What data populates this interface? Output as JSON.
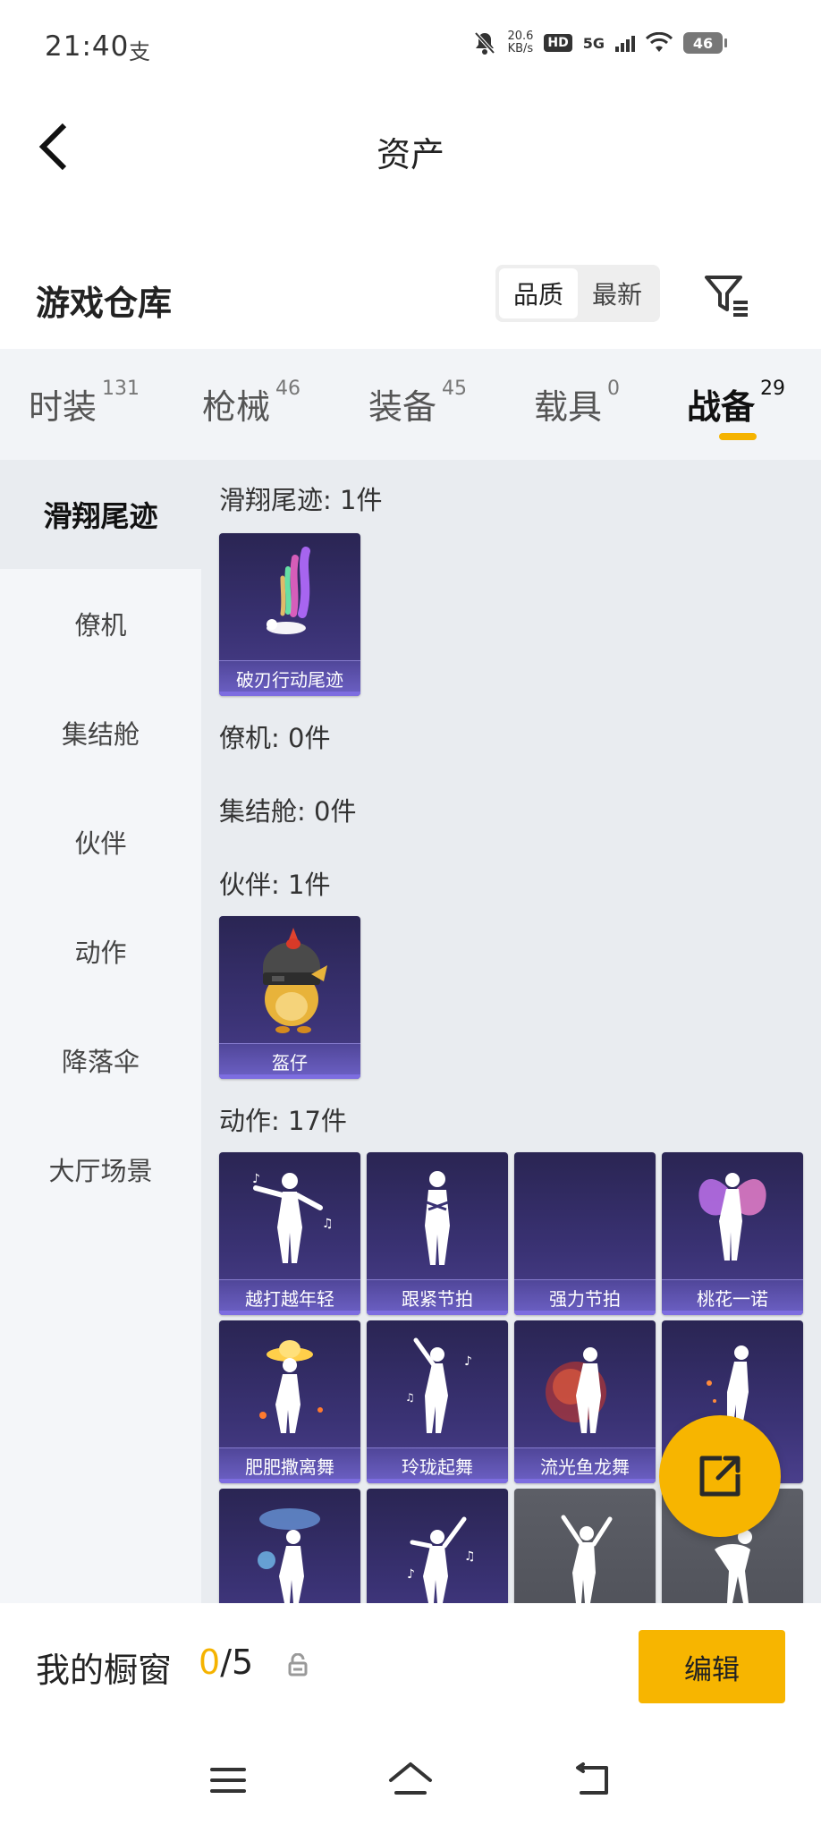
{
  "status_bar": {
    "time": "21:40",
    "alipay_icon": "支",
    "speed_value": "20.6",
    "speed_unit": "KB/s",
    "hd": "HD",
    "network": "5G",
    "battery": "46",
    "icons": [
      "mute-bell-icon",
      "signal-icon",
      "wifi-icon",
      "battery-icon"
    ]
  },
  "header": {
    "title": "资产",
    "back_icon": "chevron-left-icon"
  },
  "warehouse": {
    "title": "游戏仓库",
    "sort_options": [
      "品质",
      "最新"
    ],
    "sort_selected": "品质",
    "filter_icon": "filter-list-icon"
  },
  "tabs": [
    {
      "label": "时装",
      "count": "131"
    },
    {
      "label": "枪械",
      "count": "46"
    },
    {
      "label": "装备",
      "count": "45"
    },
    {
      "label": "载具",
      "count": "0"
    },
    {
      "label": "战备",
      "count": "29",
      "active": true
    }
  ],
  "sidebar": {
    "items": [
      "滑翔尾迹",
      "僚机",
      "集结舱",
      "伙伴",
      "动作",
      "降落伞",
      "大厅场景"
    ],
    "active": "滑翔尾迹"
  },
  "sections": {
    "glide_trail": {
      "label": "滑翔尾迹: 1件",
      "items": [
        "破刃行动尾迹"
      ]
    },
    "wingman": {
      "label": "僚机: 0件"
    },
    "rally_pod": {
      "label": "集结舱: 0件"
    },
    "companion": {
      "label": "伙伴: 1件",
      "items": [
        "盔仔"
      ]
    },
    "emotes": {
      "label": "动作: 17件",
      "items": [
        "越打越年轻",
        "跟紧节拍",
        "强力节拍",
        "桃花一诺",
        "肥肥撒离舞",
        "玲珑起舞",
        "流光鱼龙舞"
      ]
    }
  },
  "fab_icon": "share-external-icon",
  "showcase": {
    "title": "我的橱窗",
    "current": "0",
    "total": "/5",
    "lock_icon": "lock-icon",
    "edit_label": "编辑"
  },
  "nav": {
    "icons": [
      "menu-icon",
      "home-icon",
      "back-icon"
    ]
  },
  "colors": {
    "accent": "#f5b300",
    "card_top": "#2a2553",
    "card_bottom": "#4a3f8c",
    "sidebar_bg": "#f4f6f9",
    "content_bg": "#e9ecf0"
  }
}
